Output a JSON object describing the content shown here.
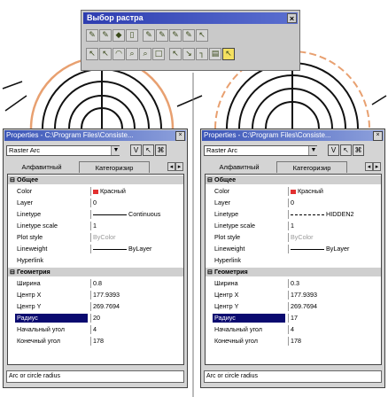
{
  "raster_toolbar": {
    "title": "Выбор растра",
    "close_label": "×",
    "row1_icons": [
      "raster-select-icon",
      "raster-select-2-icon",
      "raster-fill-icon",
      "raster-page-icon",
      "raster-select-3-icon",
      "raster-select-4-icon",
      "raster-select-5-icon",
      "raster-select-6-icon",
      "raster-pointer-icon"
    ],
    "row2_icons": [
      "arrow-select-icon",
      "arrow-select-2-icon",
      "arc-select-icon",
      "zoom-select-icon",
      "zoom-select-2-icon",
      "rect-select-icon",
      "arrow-select-3-icon",
      "arrow-select-4-icon",
      "corner-select-icon",
      "page-select-icon",
      "pointer-select-icon"
    ]
  },
  "panels": [
    {
      "title": "Properties - C:\\Program Files\\Consiste...",
      "selection": "Raster Arc",
      "tab_alpha": "Алфавитный",
      "tab_cat": "Категоризир",
      "rows": [
        {
          "type": "group",
          "name": "Общее"
        },
        {
          "name": "Color",
          "value": "Красный",
          "swatch": true
        },
        {
          "name": "Layer",
          "value": "0"
        },
        {
          "name": "Linetype",
          "value": "Continuous",
          "linetype": "solid"
        },
        {
          "name": "Linetype scale",
          "value": "1"
        },
        {
          "name": "Plot style",
          "value": "ByColor",
          "dim": true
        },
        {
          "name": "Lineweight",
          "value": "ByLayer",
          "linetype": "solid"
        },
        {
          "name": "Hyperlink",
          "value": ""
        },
        {
          "type": "group",
          "name": "Геометрия"
        },
        {
          "name": "Ширина",
          "value": "0.8"
        },
        {
          "name": "Центр X",
          "value": "177.9393"
        },
        {
          "name": "Центр Y",
          "value": "269.7694"
        },
        {
          "name": "Радиус",
          "value": "20",
          "highlight": true
        },
        {
          "name": "Начальный угол",
          "value": "4"
        },
        {
          "name": "Конечный угол",
          "value": "178"
        }
      ],
      "status": "Arc or circle radius"
    },
    {
      "title": "Properties - C:\\Program Files\\Consiste...",
      "selection": "Raster Arc",
      "tab_alpha": "Алфавитный",
      "tab_cat": "Категоризир",
      "rows": [
        {
          "type": "group",
          "name": "Общее"
        },
        {
          "name": "Color",
          "value": "Красный",
          "swatch": true
        },
        {
          "name": "Layer",
          "value": "0"
        },
        {
          "name": "Linetype",
          "value": "HIDDEN2",
          "linetype": "dash"
        },
        {
          "name": "Linetype scale",
          "value": "1"
        },
        {
          "name": "Plot style",
          "value": "ByColor",
          "dim": true
        },
        {
          "name": "Lineweight",
          "value": "ByLayer",
          "linetype": "solid"
        },
        {
          "name": "Hyperlink",
          "value": ""
        },
        {
          "type": "group",
          "name": "Геометрия"
        },
        {
          "name": "Ширина",
          "value": "0.3"
        },
        {
          "name": "Центр X",
          "value": "177.9393"
        },
        {
          "name": "Центр Y",
          "value": "269.7694"
        },
        {
          "name": "Радиус",
          "value": "17",
          "highlight": true
        },
        {
          "name": "Начальный угол",
          "value": "4"
        },
        {
          "name": "Конечный угол",
          "value": "178"
        }
      ],
      "status": "Arc or circle radius"
    }
  ],
  "colors": {
    "arc_highlight": "#e8a070",
    "title_bar": "#3a55b8",
    "selected_row": "#0a0a70"
  }
}
